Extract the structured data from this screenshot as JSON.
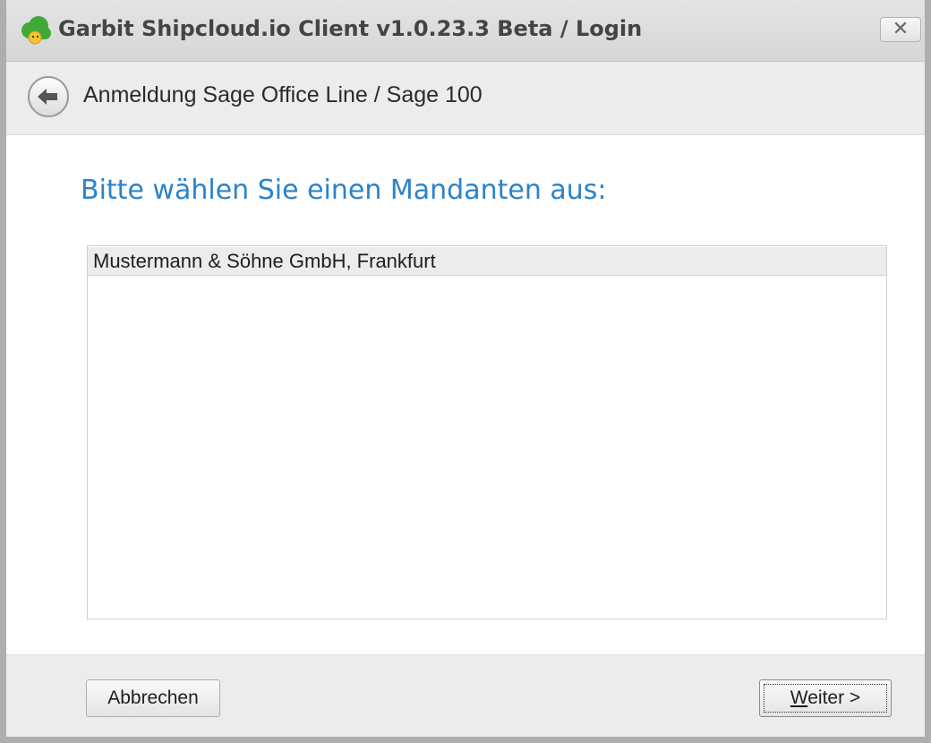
{
  "window": {
    "title": "Garbit Shipcloud.io Client v1.0.23.3 Beta / Login",
    "close_label": "✕"
  },
  "nav": {
    "title": "Anmeldung Sage Office Line / Sage 100"
  },
  "content": {
    "heading": "Bitte wählen Sie einen Mandanten aus:",
    "clients": [
      "Mustermann & Söhne GmbH, Frankfurt"
    ]
  },
  "footer": {
    "cancel_label": "Abbrechen",
    "next_mnemonic": "W",
    "next_rest": "eiter >"
  },
  "colors": {
    "accent": "#2b83c9",
    "app_icon_green": "#3faa3a",
    "app_icon_yellow": "#f4c531"
  }
}
